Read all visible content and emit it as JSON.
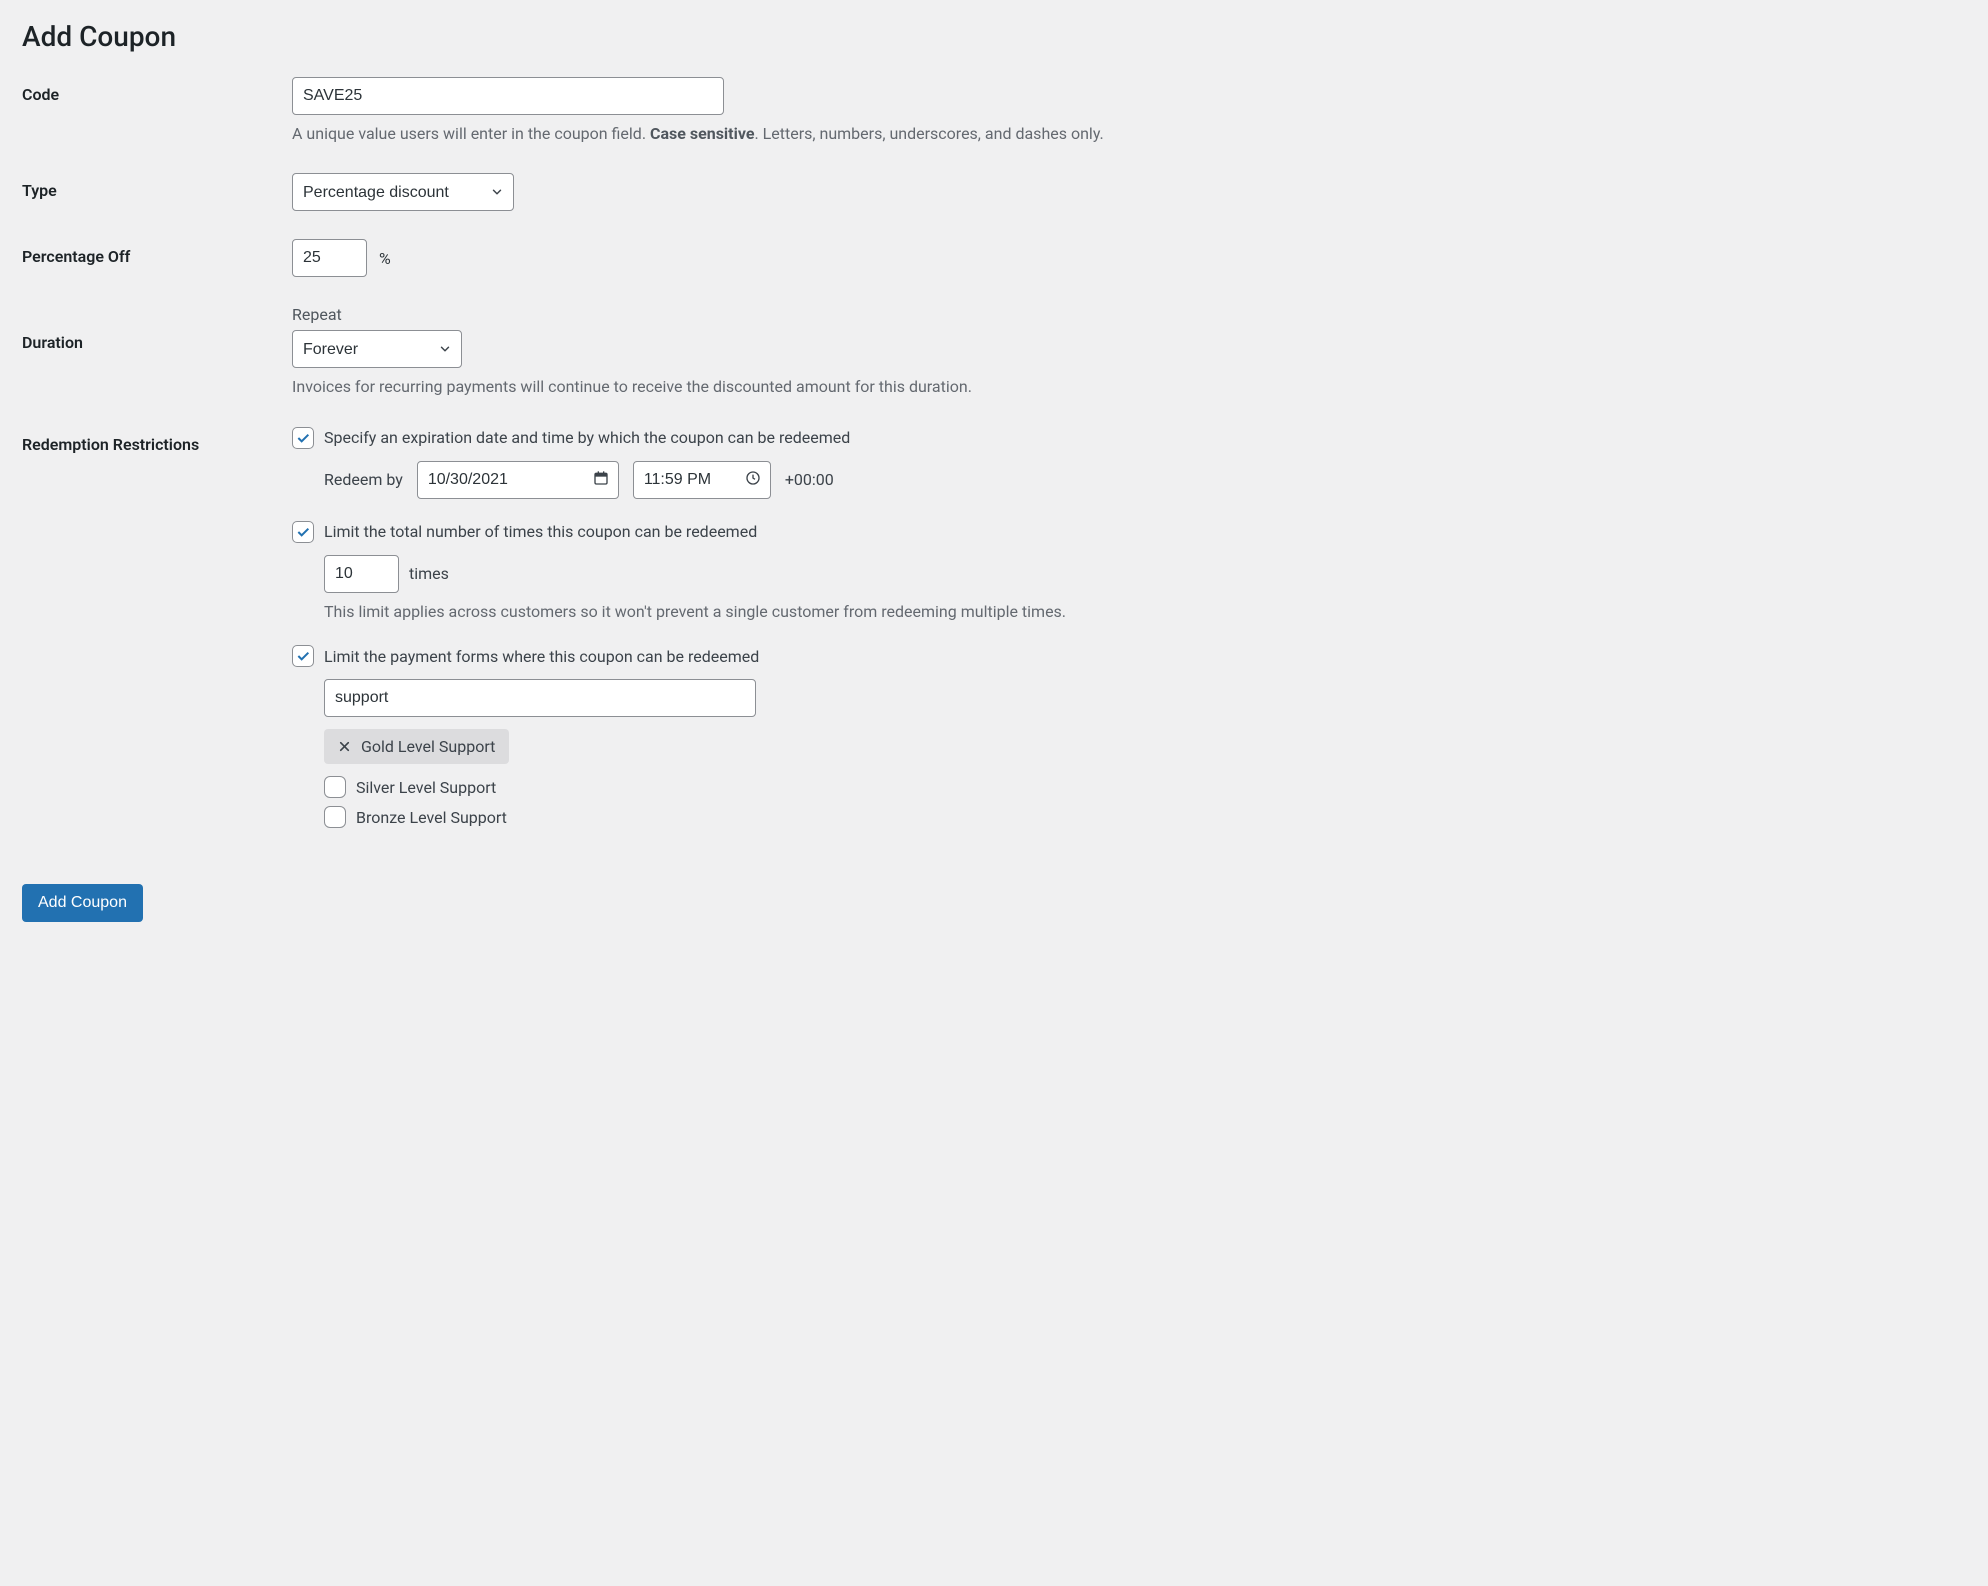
{
  "page": {
    "title": "Add Coupon"
  },
  "form": {
    "code": {
      "label": "Code",
      "value": "SAVE25",
      "help_pre": "A unique value users will enter in the coupon field. ",
      "help_strong": "Case sensitive",
      "help_post": ". Letters, numbers, underscores, and dashes only."
    },
    "type": {
      "label": "Type",
      "selected": "Percentage discount"
    },
    "percentage": {
      "label": "Percentage Off",
      "value": "25",
      "suffix": "%"
    },
    "duration": {
      "label": "Duration",
      "sublabel": "Repeat",
      "selected": "Forever",
      "help": "Invoices for recurring payments will continue to receive the discounted amount for this duration."
    },
    "restrictions": {
      "label": "Redemption Restrictions",
      "expiration": {
        "checked": true,
        "text": "Specify an expiration date and time by which the coupon can be redeemed",
        "redeem_by_label": "Redeem by",
        "date": "10/30/2021",
        "time": "11:59 PM",
        "tz": "+00:00"
      },
      "limit_total": {
        "checked": true,
        "text": "Limit the total number of times this coupon can be redeemed",
        "value": "10",
        "suffix": "times",
        "help": "This limit applies across customers so it won't prevent a single customer from redeeming multiple times."
      },
      "limit_forms": {
        "checked": true,
        "text": "Limit the payment forms where this coupon can be redeemed",
        "filter_value": "support",
        "selected_chip": "Gold Level Support",
        "options": [
          {
            "label": "Silver Level Support",
            "checked": false
          },
          {
            "label": "Bronze Level Support",
            "checked": false
          }
        ]
      }
    }
  },
  "actions": {
    "submit": "Add Coupon"
  }
}
